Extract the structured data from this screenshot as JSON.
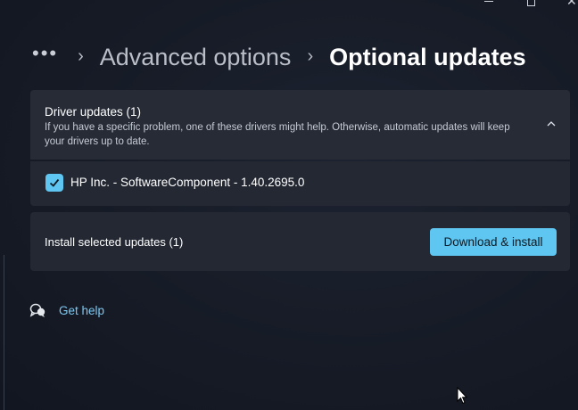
{
  "window": {
    "minimize_icon": "minimize-icon",
    "maximize_icon": "maximize-icon",
    "close_icon": "close-icon"
  },
  "breadcrumb": {
    "more": "•••",
    "sep": "›",
    "item1": "Advanced options",
    "current": "Optional updates"
  },
  "driver_updates": {
    "title": "Driver updates (1)",
    "description": "If you have a specific problem, one of these drivers might help. Otherwise, automatic updates will keep your drivers up to date.",
    "expanded": true,
    "items": [
      {
        "label": "HP Inc. - SoftwareComponent - 1.40.2695.0",
        "checked": true
      }
    ]
  },
  "install": {
    "label": "Install selected updates (1)",
    "button": "Download & install"
  },
  "help": {
    "label": "Get help"
  },
  "colors": {
    "accent": "#5fc6f1",
    "link": "#7fc8f0",
    "card": "#232833"
  }
}
